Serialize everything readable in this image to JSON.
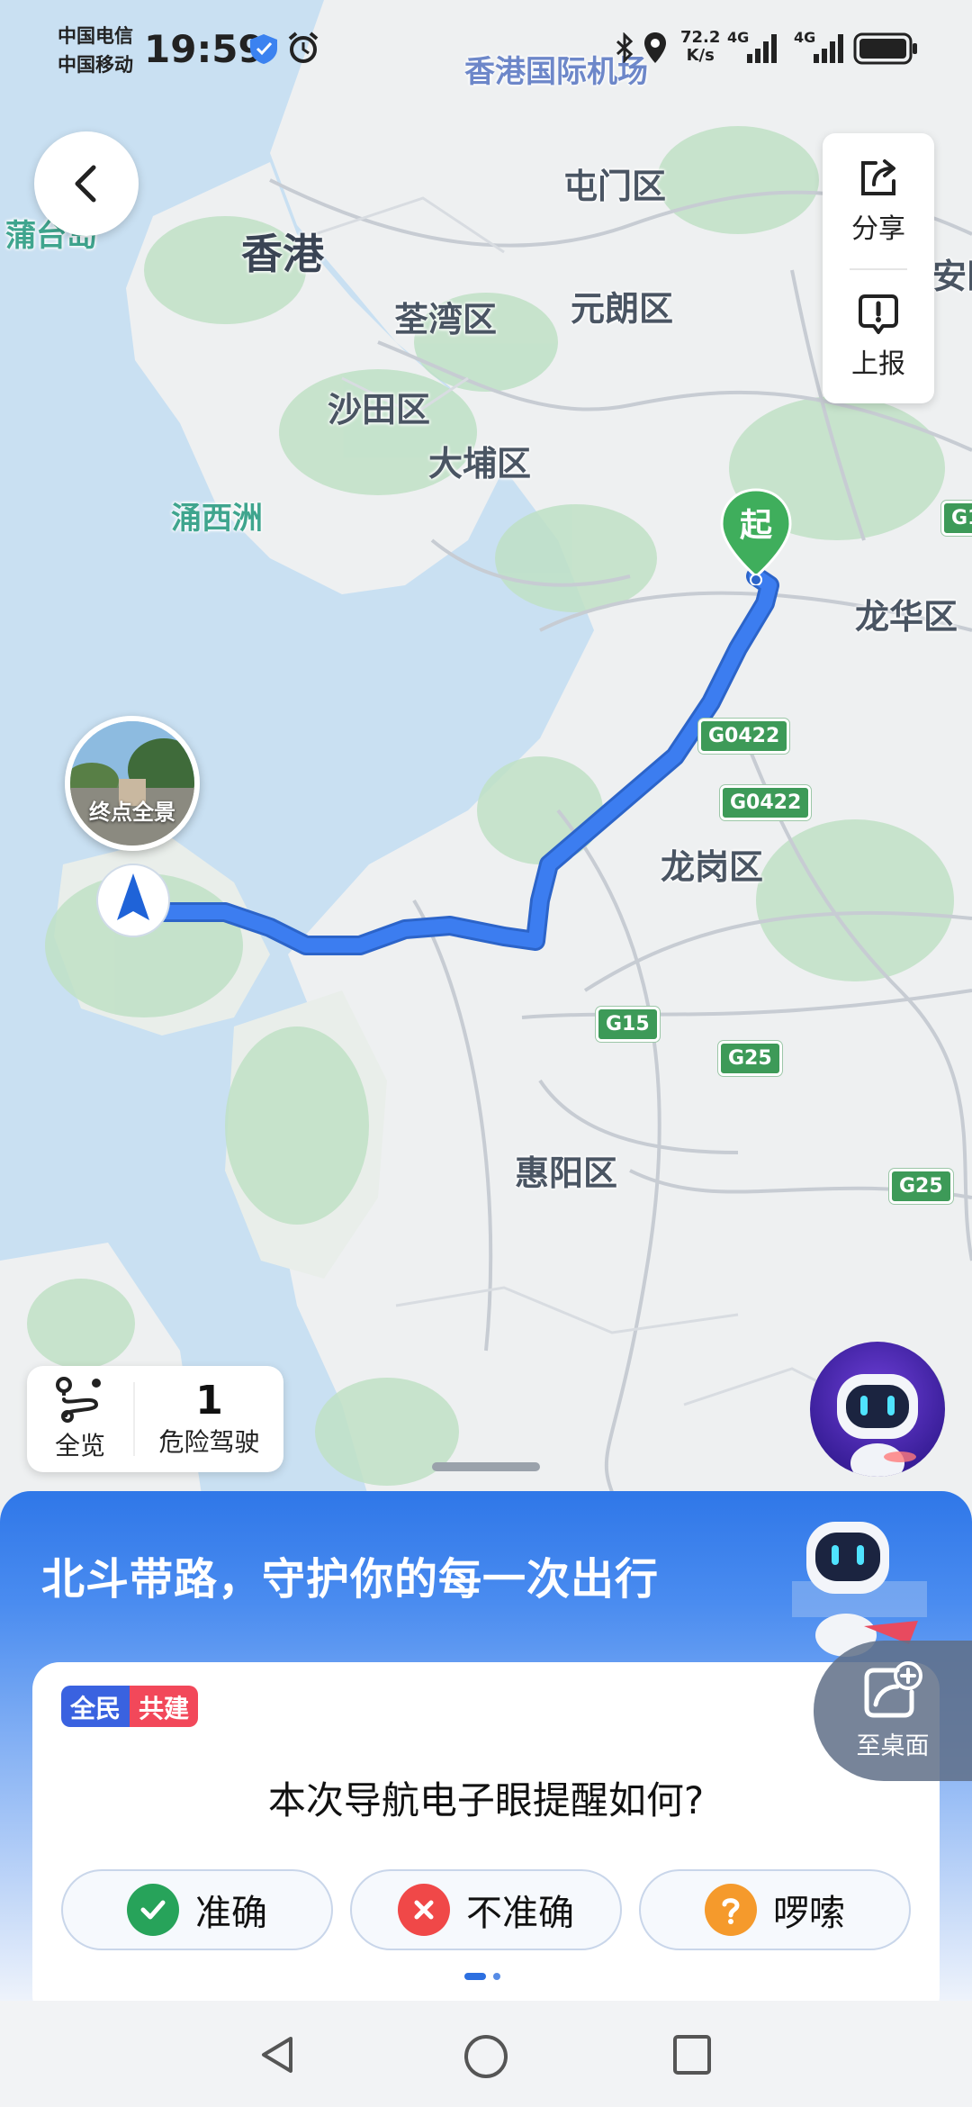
{
  "status_bar": {
    "carrier1": "中国电信",
    "carrier2": "中国移动",
    "time": "19:59",
    "net_speed": "72.2",
    "net_unit": "K/s",
    "signal1": "4G",
    "signal2": "4G"
  },
  "map": {
    "labels": {
      "airport": "香港国际机场",
      "hongkong": "香港",
      "tuenmun": "屯门区",
      "tsuenwan": "荃湾区",
      "yuenlong": "元朗区",
      "shatin": "沙田区",
      "taipo": "大埔区",
      "yungshue": "涌西洲",
      "longhua": "龙华区",
      "longgang": "龙岗区",
      "huiyang": "惠阳区",
      "left_edge": "蒲台岛",
      "right_edge": "安区"
    },
    "shields": {
      "g0422_a": "G0422",
      "g0422_b": "G0422",
      "g15": "G15",
      "g25_a": "G25",
      "g25_b": "G25",
      "g1": "G1"
    },
    "start_marker": "起",
    "endpoint_panorama": "终点全景"
  },
  "toolbar": {
    "share_label": "分享",
    "report_label": "上报"
  },
  "overview": {
    "overview_label": "全览",
    "danger_count": "1",
    "danger_label": "危险驾驶"
  },
  "sheet": {
    "banner_text": "北斗带路，守护你的每一次出行",
    "badge_left": "全民",
    "badge_right": "共建",
    "question": "本次导航电子眼提醒如何?",
    "choices": {
      "accurate": "准确",
      "inaccurate": "不准确",
      "verbose": "啰嗦"
    },
    "to_desktop": "至桌面"
  },
  "colors": {
    "route": "#3c7df0",
    "accent": "#2f77e8",
    "start_pin": "#3fae5c",
    "accurate_icon": "#27a35a",
    "inaccurate_icon": "#f04848",
    "verbose_icon": "#f59a2c"
  }
}
